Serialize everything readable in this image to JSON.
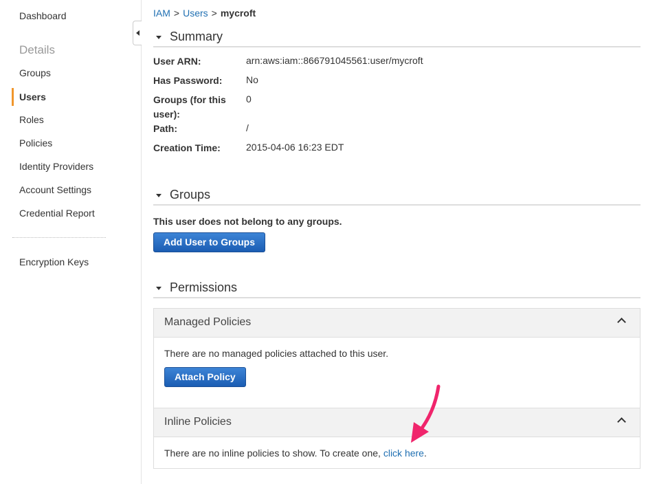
{
  "sidebar": {
    "dashboard": "Dashboard",
    "heading": "Details",
    "items": [
      "Groups",
      "Users",
      "Roles",
      "Policies",
      "Identity Providers",
      "Account Settings",
      "Credential Report"
    ],
    "active": "Users",
    "encryption": "Encryption Keys"
  },
  "breadcrumb": {
    "root": "IAM",
    "sep1": ">",
    "section": "Users",
    "sep2": ">",
    "current": "mycroft"
  },
  "summary": {
    "title": "Summary",
    "rows": [
      {
        "label": "User ARN:",
        "value": "arn:aws:iam::866791045561:user/mycroft"
      },
      {
        "label": "Has Password:",
        "value": "No"
      },
      {
        "label": "Groups (for this user):",
        "value": "0"
      },
      {
        "label": "Path:",
        "value": "/"
      },
      {
        "label": "Creation Time:",
        "value": "2015-04-06 16:23 EDT"
      }
    ]
  },
  "groups": {
    "title": "Groups",
    "message": "This user does not belong to any groups.",
    "button": "Add User to Groups"
  },
  "permissions": {
    "title": "Permissions",
    "managed": {
      "title": "Managed Policies",
      "message": "There are no managed policies attached to this user.",
      "button": "Attach Policy"
    },
    "inline": {
      "title": "Inline Policies",
      "message": "There are no inline policies to show. To create one,",
      "link": "click here",
      "period": "."
    }
  },
  "annotation": {
    "arrow_color": "#f0256c"
  }
}
